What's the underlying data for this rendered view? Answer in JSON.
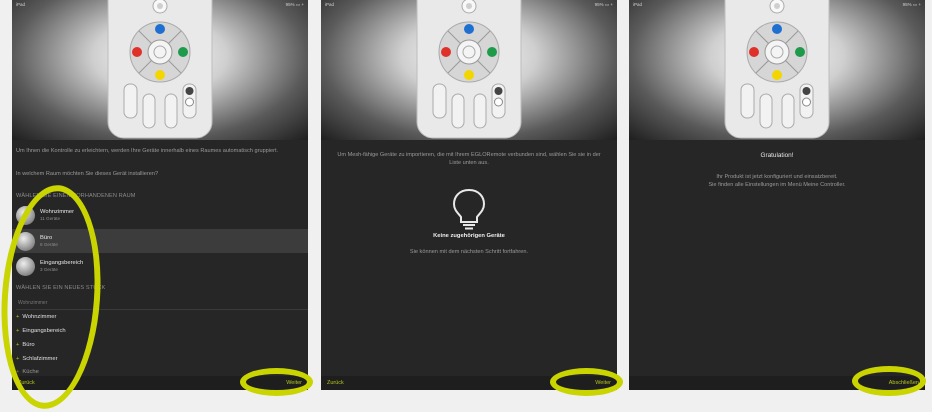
{
  "status": {
    "carrier": "iPad",
    "battery": "95% ▭ +"
  },
  "screen1": {
    "intro": "Um Ihnen die Kontrolle zu erleichtern, werden Ihre Geräte innerhalb eines Raumes automatisch gruppiert.",
    "question": "In welchem Raum möchten Sie dieses Gerät installieren?",
    "existing_header": "WÄHLEN SIE EINEN VORHANDENEN RAUM",
    "rooms": [
      {
        "name": "Wohnzimmer",
        "count": "11 Geräte"
      },
      {
        "name": "Büro",
        "count": "8 Geräte"
      },
      {
        "name": "Eingangsbereich",
        "count": "3 Geräte"
      }
    ],
    "new_header": "WÄHLEN SIE EIN NEUES STÜCK",
    "new_placeholder": "Wohnzimmer",
    "new_rooms": [
      "Wohnzimmer",
      "Eingangsbereich",
      "Büro",
      "Schlafzimmer",
      "Küche"
    ],
    "back": "Zurück",
    "next": "Weiter"
  },
  "screen2": {
    "intro": "Um Mesh-fähige Geräte zu importieren, die mit Ihrem EGLORemote verbunden sind, wählen Sie sie in der Liste unten aus.",
    "empty_title": "Keine zugehörigen Geräte",
    "empty_sub": "Sie können mit dem nächsten Schritt fortfahren.",
    "back": "Zurück",
    "next": "Weiter"
  },
  "screen3": {
    "title": "Gratulation!",
    "line1": "Ihr Produkt ist jetzt konfiguriert und einsatzbereit.",
    "line2": "Sie finden alle Einstellungen im Menü Meine Controller.",
    "finish": "Abschließen"
  },
  "colors": {
    "accent": "#b3c61a",
    "highlight_oval": "#c9d400",
    "screen_bg": "#262626"
  },
  "icons": [
    "remote-control-icon",
    "lightbulb-icon",
    "room-avatar-icon",
    "plus-icon"
  ]
}
